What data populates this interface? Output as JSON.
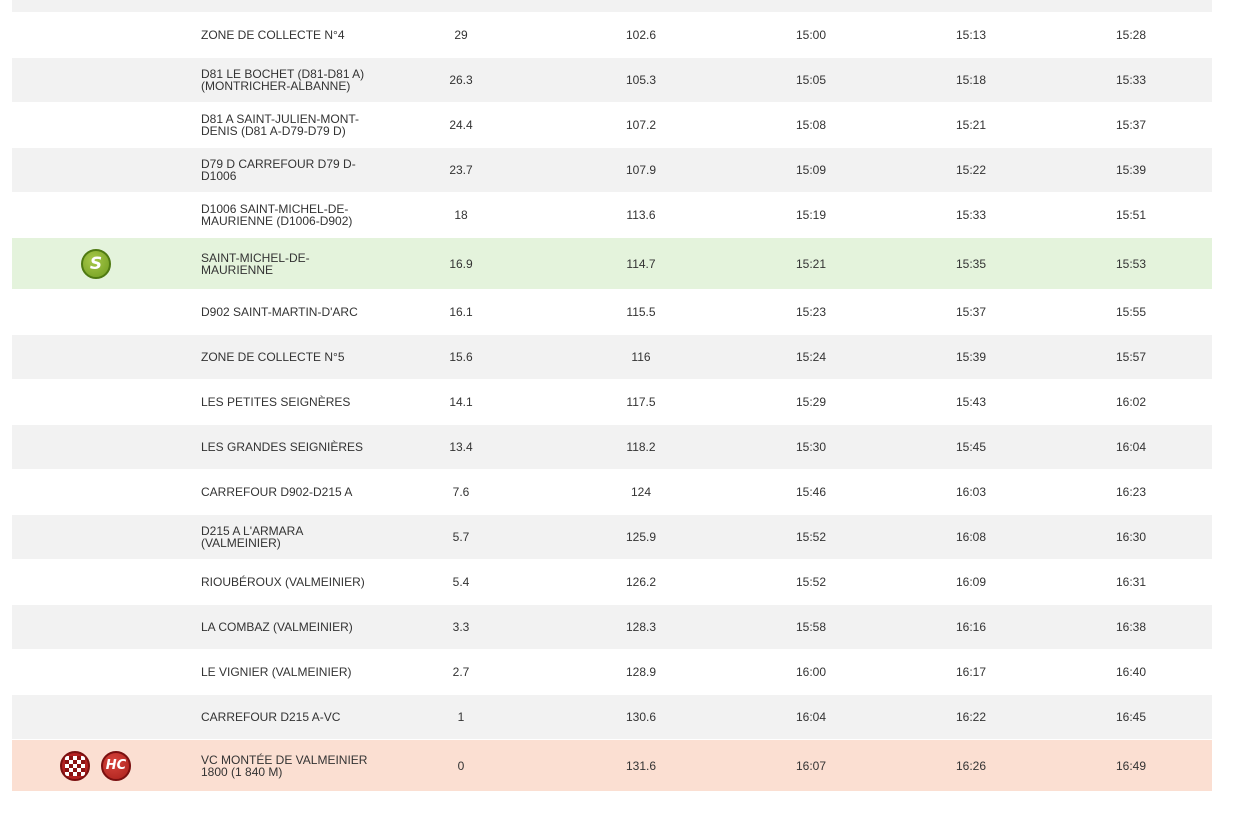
{
  "rows": [
    {
      "name": "ZONE DE COLLECTE N°4",
      "km_to_go": "29",
      "km_done": "102.6",
      "t1": "15:00",
      "t2": "15:13",
      "t3": "15:28",
      "style": "white"
    },
    {
      "name": "D81 LE BOCHET (D81-D81 A) (MONTRICHER-ALBANNE)",
      "km_to_go": "26.3",
      "km_done": "105.3",
      "t1": "15:05",
      "t2": "15:18",
      "t3": "15:33",
      "style": "alt"
    },
    {
      "name": "D81 A SAINT-JULIEN-MONT-DENIS (D81 A-D79-D79 D)",
      "km_to_go": "24.4",
      "km_done": "107.2",
      "t1": "15:08",
      "t2": "15:21",
      "t3": "15:37",
      "style": "white"
    },
    {
      "name": "D79 D CARREFOUR D79 D-D1006",
      "km_to_go": "23.7",
      "km_done": "107.9",
      "t1": "15:09",
      "t2": "15:22",
      "t3": "15:39",
      "style": "alt"
    },
    {
      "name": "D1006 SAINT-MICHEL-DE-MAURIENNE (D1006-D902)",
      "km_to_go": "18",
      "km_done": "113.6",
      "t1": "15:19",
      "t2": "15:33",
      "t3": "15:51",
      "style": "white"
    },
    {
      "name": "SAINT-MICHEL-DE-MAURIENNE",
      "km_to_go": "16.9",
      "km_done": "114.7",
      "t1": "15:21",
      "t2": "15:35",
      "t3": "15:53",
      "style": "sprint",
      "badge": "S"
    },
    {
      "name": "D902 SAINT-MARTIN-D'ARC",
      "km_to_go": "16.1",
      "km_done": "115.5",
      "t1": "15:23",
      "t2": "15:37",
      "t3": "15:55",
      "style": "white"
    },
    {
      "name": "ZONE DE COLLECTE N°5",
      "km_to_go": "15.6",
      "km_done": "116",
      "t1": "15:24",
      "t2": "15:39",
      "t3": "15:57",
      "style": "alt"
    },
    {
      "name": "LES PETITES SEIGNÈRES",
      "km_to_go": "14.1",
      "km_done": "117.5",
      "t1": "15:29",
      "t2": "15:43",
      "t3": "16:02",
      "style": "white"
    },
    {
      "name": "LES GRANDES SEIGNIÈRES",
      "km_to_go": "13.4",
      "km_done": "118.2",
      "t1": "15:30",
      "t2": "15:45",
      "t3": "16:04",
      "style": "alt"
    },
    {
      "name": "CARREFOUR D902-D215 A",
      "km_to_go": "7.6",
      "km_done": "124",
      "t1": "15:46",
      "t2": "16:03",
      "t3": "16:23",
      "style": "white"
    },
    {
      "name": "D215 A L'ARMARA (VALMEINIER)",
      "km_to_go": "5.7",
      "km_done": "125.9",
      "t1": "15:52",
      "t2": "16:08",
      "t3": "16:30",
      "style": "alt"
    },
    {
      "name": "RIOUBÉROUX (VALMEINIER)",
      "km_to_go": "5.4",
      "km_done": "126.2",
      "t1": "15:52",
      "t2": "16:09",
      "t3": "16:31",
      "style": "white"
    },
    {
      "name": "LA COMBAZ (VALMEINIER)",
      "km_to_go": "3.3",
      "km_done": "128.3",
      "t1": "15:58",
      "t2": "16:16",
      "t3": "16:38",
      "style": "alt"
    },
    {
      "name": "LE VIGNIER (VALMEINIER)",
      "km_to_go": "2.7",
      "km_done": "128.9",
      "t1": "16:00",
      "t2": "16:17",
      "t3": "16:40",
      "style": "white"
    },
    {
      "name": "CARREFOUR D215 A-VC",
      "km_to_go": "1",
      "km_done": "130.6",
      "t1": "16:04",
      "t2": "16:22",
      "t3": "16:45",
      "style": "alt"
    },
    {
      "name": "VC MONTÉE DE VALMEINIER 1800 (1 840 M)",
      "km_to_go": "0",
      "km_done": "131.6",
      "t1": "16:07",
      "t2": "16:26",
      "t3": "16:49",
      "style": "finish",
      "badge": "HC"
    }
  ],
  "icons": {
    "sprint": "sprint-point-icon",
    "finish": "finish-flag-icon",
    "hc": "hors-categorie-climb-icon"
  },
  "colors": {
    "row_alt": "#f2f2f2",
    "sprint_bg": "#e4f3dc",
    "finish_bg": "#fbdfd2",
    "sprint_badge": "#7fa82a",
    "hc_badge": "#c0302a"
  }
}
